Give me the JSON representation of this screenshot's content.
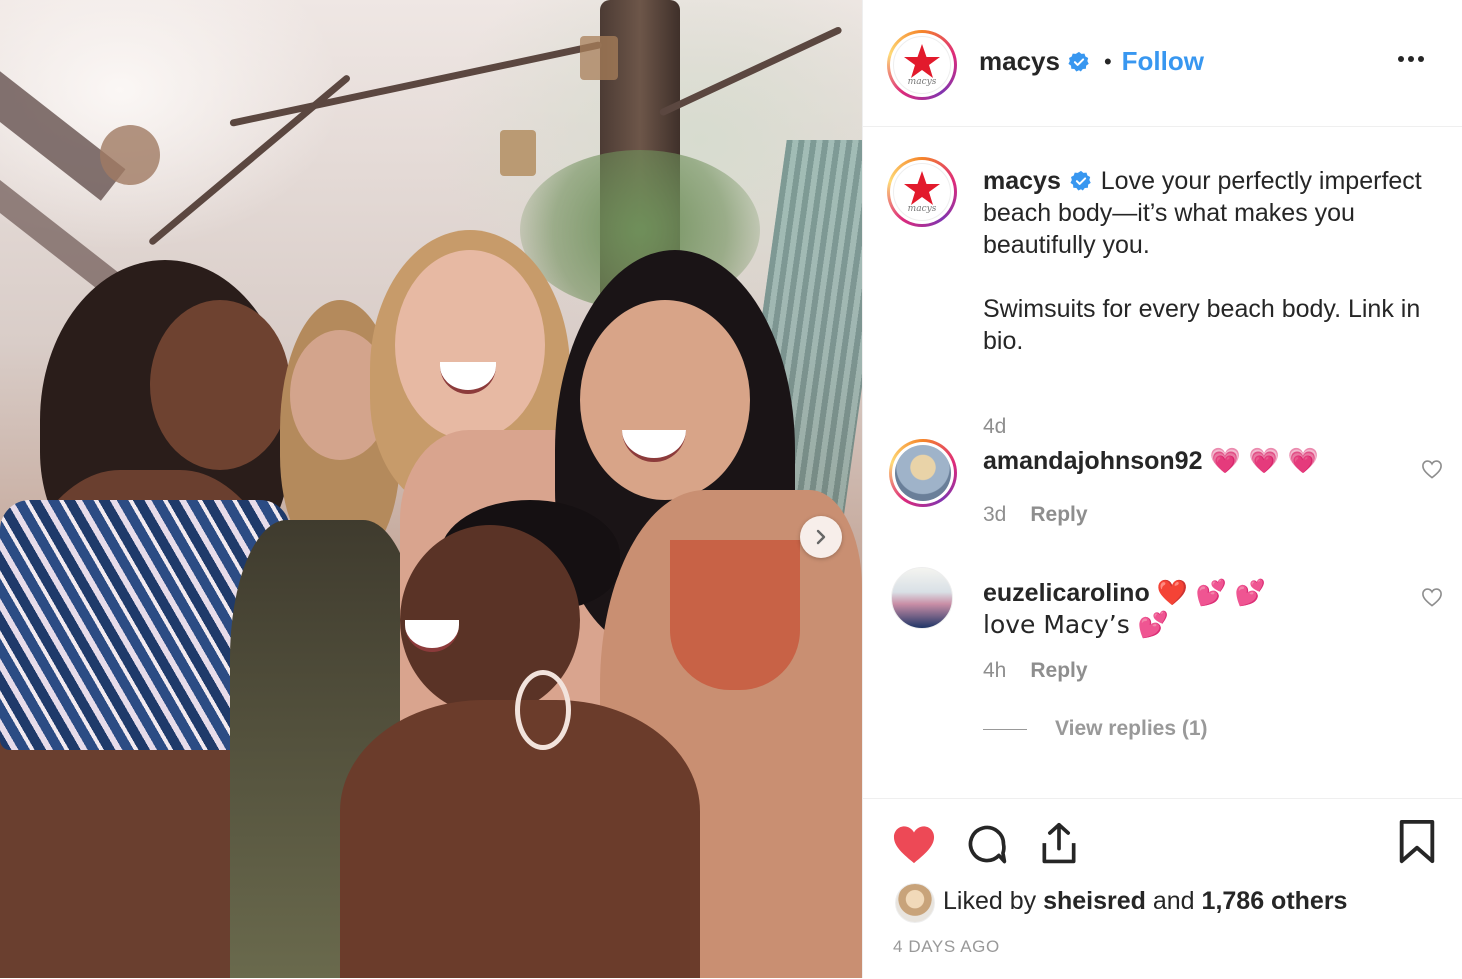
{
  "post": {
    "username": "macys",
    "separator": "•",
    "follow_label": "Follow",
    "more_label": "•••",
    "logo_text": "macys"
  },
  "caption": {
    "username": "macys",
    "text_line1": "Love your perfectly imperfect beach body—it’s what makes you beautifully you.",
    "text_line2": "Swimsuits for every beach body. Link in bio.",
    "age": "4d"
  },
  "comments": [
    {
      "username": "amandajohnson92",
      "text": "💗 💗 💗",
      "age": "3d",
      "reply_label": "Reply"
    },
    {
      "username": "euzelicarolino",
      "text": "❤️ 💕 💕 love Macy’s 💕",
      "age": "4h",
      "reply_label": "Reply"
    }
  ],
  "view_replies_label": "View replies (1)",
  "likes": {
    "prefix": "Liked by",
    "user": "sheisred",
    "conj": "and",
    "others": "1,786 others"
  },
  "timestamp": "4 DAYS AGO",
  "colors": {
    "accent": "#3897f0",
    "like_red": "#ed4956",
    "brand_red": "#e21a2c"
  }
}
